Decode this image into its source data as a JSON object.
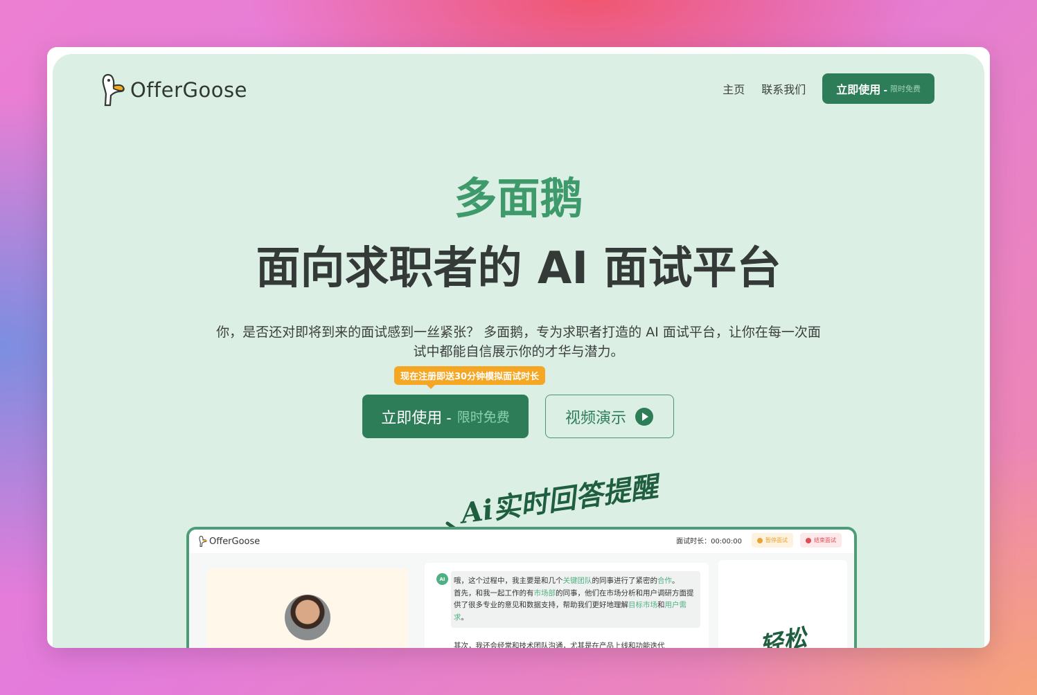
{
  "nav": {
    "logo_text": "OfferGoose",
    "links": [
      "主页",
      "联系我们"
    ],
    "cta_label": "立即使用 -",
    "cta_muted": "限时免费"
  },
  "hero": {
    "brand": "多面鹅",
    "headline": "面向求职者的 AI 面试平台",
    "description": "你，是否还对即将到来的面试感到一丝紧张？ 多面鹅，专为求职者打造的 AI 面试平台，让你在每一次面试中都能自信展示你的才华与潜力。",
    "promo_badge": "现在注册即送30分钟模拟面试时长",
    "primary_label": "立即使用 -",
    "primary_muted": "限时免费",
    "secondary_label": "视频演示"
  },
  "annotations": {
    "realtime": "Ai实时回答提醒",
    "bottom": "轻松"
  },
  "preview": {
    "logo_text": "OfferGoose",
    "timer": "面试时长：00:00:00",
    "pause_label": "暂停面试",
    "end_label": "结束面试",
    "ai_badge": "AI",
    "bubble_parts": [
      {
        "t": "哦，这个过程中，我主要是和几个",
        "h": false
      },
      {
        "t": "关键团队",
        "h": true
      },
      {
        "t": "的同事进行了紧密的",
        "h": false
      },
      {
        "t": "合作",
        "h": true
      },
      {
        "t": "。",
        "h": false
      },
      {
        "t": "首先，和我一起工作的有",
        "h": false,
        "br": true
      },
      {
        "t": "市场部",
        "h": true
      },
      {
        "t": "的同事，他们在市场分析和用户调研方面提供了很多专业的意见和数据支持，帮助我们更好地理解",
        "h": false
      },
      {
        "t": "目标市场",
        "h": true
      },
      {
        "t": "和",
        "h": false
      },
      {
        "t": "用户需求",
        "h": true
      },
      {
        "t": "。",
        "h": false
      }
    ],
    "next_line": "其次，我还会经常和技术团队沟通，尤其是在产品上线和功能迭代"
  },
  "colors": {
    "page_bg": "#dcefe5",
    "brand_green": "#3f9a6b",
    "button_green": "#2e7d59",
    "promo_orange": "#f5a623"
  }
}
